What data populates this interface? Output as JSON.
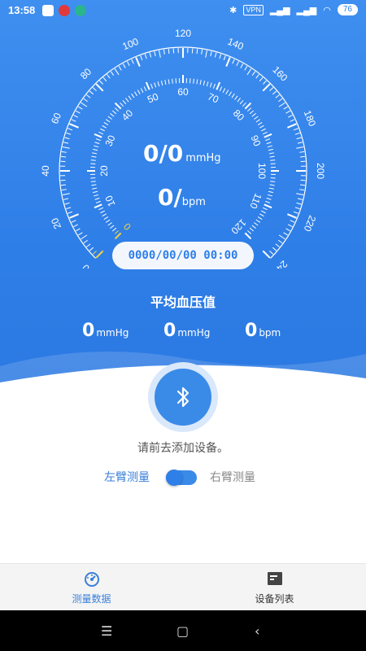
{
  "status_bar": {
    "time": "13:58",
    "vpn": "VPN",
    "battery": "76"
  },
  "gauge": {
    "outer_ticks": [
      "0",
      "20",
      "40",
      "60",
      "80",
      "100",
      "120",
      "140",
      "160",
      "180",
      "200",
      "220",
      "240"
    ],
    "inner_ticks": [
      "0",
      "10",
      "20",
      "30",
      "40",
      "50",
      "60",
      "70",
      "80",
      "90",
      "100",
      "110",
      "120"
    ],
    "bp_value": "0/0",
    "bp_unit": "mmHg",
    "hr_value": "0/",
    "hr_unit": "bpm",
    "datetime": "0000/00/00 00:00"
  },
  "average": {
    "title": "平均血压值",
    "systolic": "0",
    "systolic_unit": "mmHg",
    "diastolic": "0",
    "diastolic_unit": "mmHg",
    "pulse": "0",
    "pulse_unit": "bpm"
  },
  "device": {
    "hint": "请前去添加设备。",
    "left_arm": "左臂测量",
    "right_arm": "右臂测量",
    "selected_arm": "left"
  },
  "tabs": [
    {
      "label": "测量数据",
      "icon": "gauge-icon",
      "active": true
    },
    {
      "label": "设备列表",
      "icon": "device-list-icon",
      "active": false
    }
  ],
  "colors": {
    "primary": "#2f7fe8",
    "header_bg": "#3f8ff0",
    "accent_yellow": "#f5d142"
  }
}
